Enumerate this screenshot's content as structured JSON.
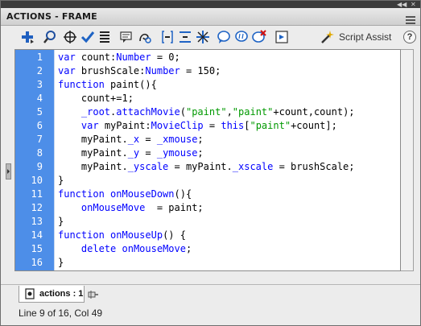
{
  "panel": {
    "title": "ACTIONS - FRAME"
  },
  "toolbar": {
    "buttons": [
      {
        "name": "add-statement-button",
        "icon": "plus-icon"
      },
      {
        "name": "find-button",
        "icon": "magnifier-icon"
      },
      {
        "name": "insert-target-path-button",
        "icon": "crosshair-icon"
      },
      {
        "name": "check-syntax-button",
        "icon": "checkmark-icon"
      },
      {
        "name": "auto-format-button",
        "icon": "lines-icon"
      },
      {
        "name": "show-code-hint-button",
        "icon": "code-hint-icon"
      },
      {
        "name": "debug-options-button",
        "icon": "debug-icon"
      },
      {
        "name": "collapse-between-braces-button",
        "icon": "collapse-braces-icon"
      },
      {
        "name": "collapse-selection-button",
        "icon": "collapse-selection-icon"
      },
      {
        "name": "expand-all-button",
        "icon": "expand-all-icon"
      },
      {
        "name": "apply-block-comment-button",
        "icon": "block-comment-icon"
      },
      {
        "name": "apply-line-comment-button",
        "icon": "line-comment-icon"
      },
      {
        "name": "remove-comment-button",
        "icon": "remove-comment-icon"
      },
      {
        "name": "show-hide-toolbox-button",
        "icon": "toolbox-icon"
      }
    ],
    "script_assist_label": "Script Assist",
    "help_label": "?"
  },
  "editor": {
    "line_numbers": [
      "1",
      "2",
      "3",
      "4",
      "5",
      "6",
      "7",
      "8",
      "9",
      "10",
      "11",
      "12",
      "13",
      "14",
      "15",
      "16"
    ],
    "lines": [
      [
        {
          "t": "kw",
          "v": "var"
        },
        {
          "t": "pl",
          "v": " count:"
        },
        {
          "t": "ty",
          "v": "Number"
        },
        {
          "t": "pl",
          "v": " = 0;"
        }
      ],
      [
        {
          "t": "kw",
          "v": "var"
        },
        {
          "t": "pl",
          "v": " brushScale:"
        },
        {
          "t": "ty",
          "v": "Number"
        },
        {
          "t": "pl",
          "v": " = 150;"
        }
      ],
      [
        {
          "t": "kw",
          "v": "function"
        },
        {
          "t": "pl",
          "v": " paint(){"
        }
      ],
      [
        {
          "t": "pl",
          "v": "    count+=1;"
        }
      ],
      [
        {
          "t": "pl",
          "v": "    "
        },
        {
          "t": "pr",
          "v": "_root"
        },
        {
          "t": "pl",
          "v": "."
        },
        {
          "t": "pr",
          "v": "attachMovie"
        },
        {
          "t": "pl",
          "v": "("
        },
        {
          "t": "st",
          "v": "\"paint\""
        },
        {
          "t": "pl",
          "v": ","
        },
        {
          "t": "st",
          "v": "\"paint\""
        },
        {
          "t": "pl",
          "v": "+count,count);"
        }
      ],
      [
        {
          "t": "pl",
          "v": "    "
        },
        {
          "t": "kw",
          "v": "var"
        },
        {
          "t": "pl",
          "v": " myPaint:"
        },
        {
          "t": "ty",
          "v": "MovieClip"
        },
        {
          "t": "pl",
          "v": " = "
        },
        {
          "t": "kw",
          "v": "this"
        },
        {
          "t": "pl",
          "v": "["
        },
        {
          "t": "st",
          "v": "\"paint\""
        },
        {
          "t": "pl",
          "v": "+count];"
        }
      ],
      [
        {
          "t": "pl",
          "v": "    myPaint."
        },
        {
          "t": "pr",
          "v": "_x"
        },
        {
          "t": "pl",
          "v": " = "
        },
        {
          "t": "pr",
          "v": "_xmouse"
        },
        {
          "t": "pl",
          "v": ";"
        }
      ],
      [
        {
          "t": "pl",
          "v": "    myPaint."
        },
        {
          "t": "pr",
          "v": "_y"
        },
        {
          "t": "pl",
          "v": " = "
        },
        {
          "t": "pr",
          "v": "_ymouse"
        },
        {
          "t": "pl",
          "v": ";"
        }
      ],
      [
        {
          "t": "pl",
          "v": "    myPaint."
        },
        {
          "t": "pr",
          "v": "_yscale"
        },
        {
          "t": "pl",
          "v": " = myPaint."
        },
        {
          "t": "pr",
          "v": "_xscale"
        },
        {
          "t": "pl",
          "v": " = brushScale;"
        }
      ],
      [
        {
          "t": "pl",
          "v": "}"
        }
      ],
      [
        {
          "t": "kw",
          "v": "function"
        },
        {
          "t": "pl",
          "v": " "
        },
        {
          "t": "pr",
          "v": "onMouseDown"
        },
        {
          "t": "pl",
          "v": "(){"
        }
      ],
      [
        {
          "t": "pl",
          "v": "    "
        },
        {
          "t": "pr",
          "v": "onMouseMove"
        },
        {
          "t": "pl",
          "v": "  = paint;"
        }
      ],
      [
        {
          "t": "pl",
          "v": "}"
        }
      ],
      [
        {
          "t": "kw",
          "v": "function"
        },
        {
          "t": "pl",
          "v": " "
        },
        {
          "t": "pr",
          "v": "onMouseUp"
        },
        {
          "t": "pl",
          "v": "() {"
        }
      ],
      [
        {
          "t": "pl",
          "v": "    "
        },
        {
          "t": "kw",
          "v": "delete"
        },
        {
          "t": "pl",
          "v": " "
        },
        {
          "t": "pr",
          "v": "onMouseMove"
        },
        {
          "t": "pl",
          "v": ";"
        }
      ],
      [
        {
          "t": "pl",
          "v": "}"
        }
      ]
    ]
  },
  "tabs": [
    {
      "label": "actions : 1"
    }
  ],
  "status": {
    "text": "Line 9 of 16, Col 49"
  },
  "colors": {
    "gutter": "#4d8ee8",
    "keyword": "#0000ff",
    "string": "#009900"
  }
}
